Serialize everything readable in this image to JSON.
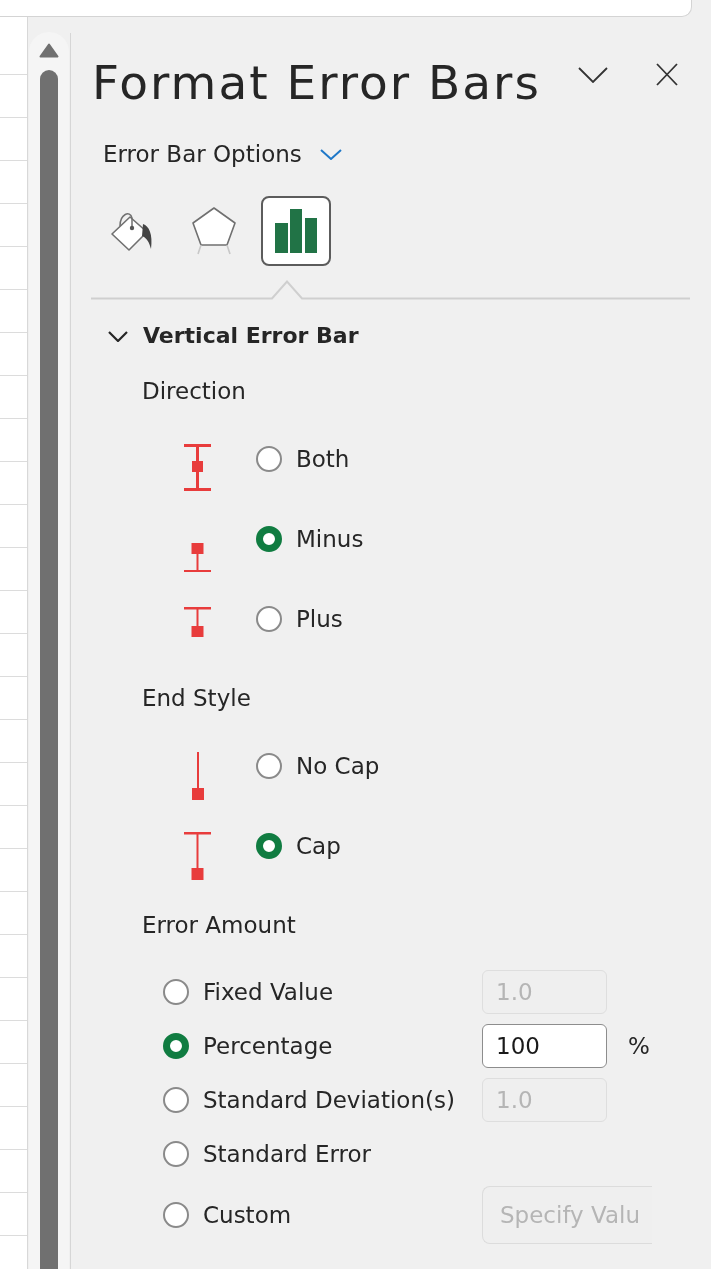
{
  "pane": {
    "title": "Format Error Bars"
  },
  "options_menu": {
    "label": "Error Bar Options"
  },
  "tabs": [
    {
      "kind": "fill-line",
      "selected": false
    },
    {
      "kind": "effects",
      "selected": false
    },
    {
      "kind": "options",
      "selected": true
    }
  ],
  "section": {
    "title": "Vertical Error Bar",
    "expanded": true,
    "groups": [
      {
        "heading": "Direction",
        "kind": "icon-radios",
        "options": [
          {
            "label": "Both",
            "kind": "both",
            "selected": false
          },
          {
            "label": "Minus",
            "kind": "minus",
            "selected": true
          },
          {
            "label": "Plus",
            "kind": "plus",
            "selected": false
          }
        ]
      },
      {
        "heading": "End Style",
        "kind": "icon-radios",
        "options": [
          {
            "label": "No Cap",
            "kind": "no-cap",
            "selected": false
          },
          {
            "label": "Cap",
            "kind": "cap",
            "selected": true
          }
        ]
      },
      {
        "heading": "Error Amount",
        "kind": "value-radios",
        "options": [
          {
            "label": "Fixed Value",
            "selected": false,
            "kind": "field",
            "field": {
              "value": "1.0",
              "disabled": true
            }
          },
          {
            "label": "Percentage",
            "selected": true,
            "kind": "field",
            "field": {
              "value": "100",
              "disabled": false
            },
            "unit": "%"
          },
          {
            "label": "Standard Deviation(s)",
            "selected": false,
            "kind": "field",
            "field": {
              "value": "1.0",
              "disabled": true
            }
          },
          {
            "label": "Standard Error",
            "selected": false,
            "kind": "plain"
          },
          {
            "label": "Custom",
            "selected": false,
            "kind": "button",
            "button": {
              "label": "Specify Valu",
              "disabled": true
            }
          }
        ]
      }
    ]
  }
}
